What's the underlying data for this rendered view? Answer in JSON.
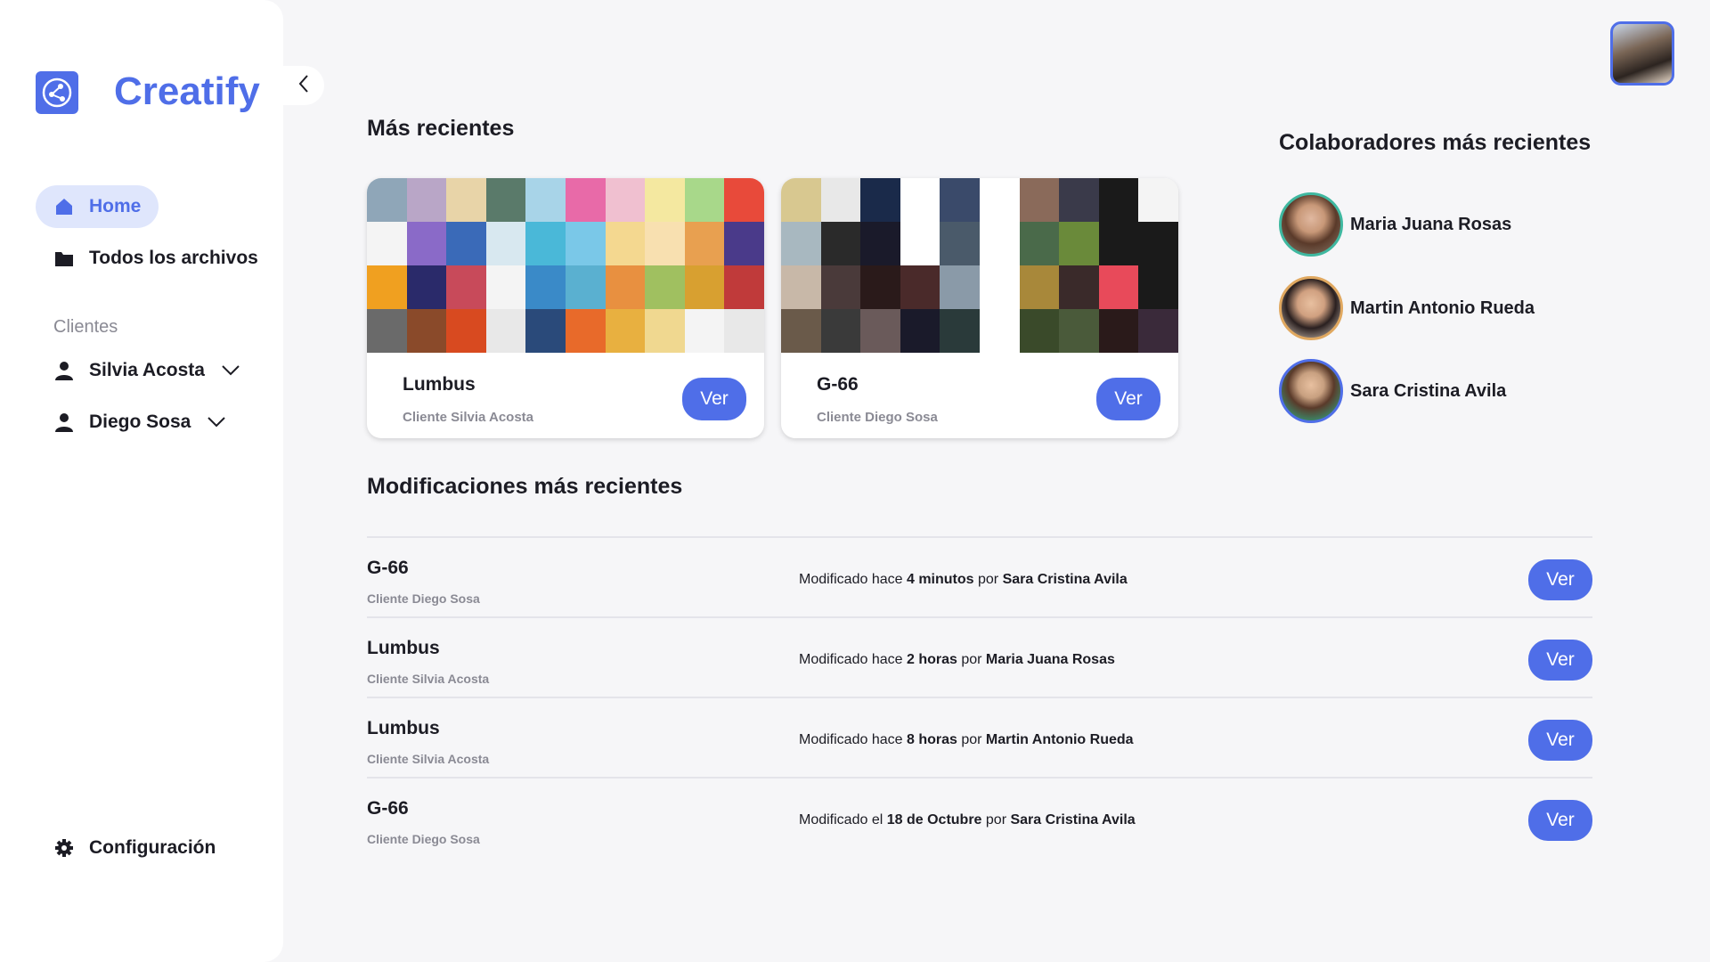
{
  "app": {
    "name": "Creatify",
    "brand_color": "#4f6ee8"
  },
  "nav": {
    "home": "Home",
    "files": "Todos los archivos",
    "clients_label": "Clientes",
    "clients": [
      "Silvia Acosta",
      "Diego Sosa"
    ],
    "config": "Configuración"
  },
  "recent": {
    "heading": "Más recientes",
    "cards": [
      {
        "title": "Lumbus",
        "client": "Cliente Silvia Acosta",
        "button": "Ver"
      },
      {
        "title": "G-66",
        "client": "Cliente Diego Sosa",
        "button": "Ver"
      }
    ]
  },
  "collaborators": {
    "heading": "Colaboradores más recientes",
    "people": [
      "Maria Juana Rosas",
      "Martin Antonio Rueda",
      "Sara Cristina Avila"
    ]
  },
  "modifications": {
    "heading": "Modificaciones más recientes",
    "rows": [
      {
        "title": "G-66",
        "client": "Cliente Diego Sosa",
        "prefix": "Modificado hace",
        "when": "4 minutos",
        "by_label": "por",
        "by": "Sara Cristina Avila",
        "button": "Ver"
      },
      {
        "title": "Lumbus",
        "client": "Cliente Silvia Acosta",
        "prefix": "Modificado hace",
        "when": "2 horas",
        "by_label": "por",
        "by": "Maria Juana Rosas",
        "button": "Ver"
      },
      {
        "title": "Lumbus",
        "client": "Cliente Silvia Acosta",
        "prefix": "Modificado hace",
        "when": "8 horas",
        "by_label": "por",
        "by": "Martin Antonio Rueda",
        "button": "Ver"
      },
      {
        "title": "G-66",
        "client": "Cliente Diego Sosa",
        "prefix": "Modificado el",
        "when": "18 de Octubre",
        "by_label": "por",
        "by": "Sara Cristina Avila",
        "button": "Ver"
      }
    ]
  },
  "icons": [
    "logo-icon",
    "chevron-left-icon",
    "home-icon",
    "folder-icon",
    "user-icon",
    "chevron-down-icon",
    "gear-icon"
  ]
}
